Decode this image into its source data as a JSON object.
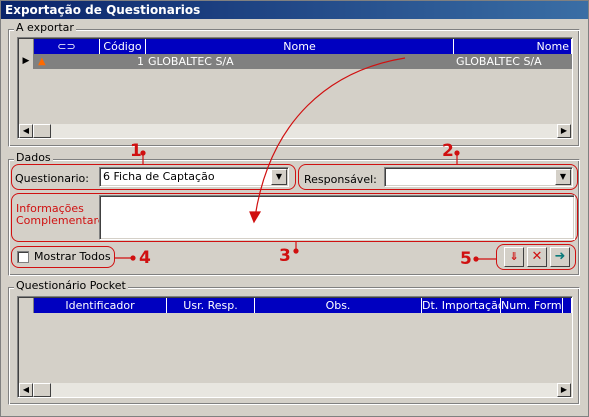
{
  "window": {
    "title": "Exportação de Questionarios"
  },
  "export_group": {
    "legend": "A exportar",
    "columns": [
      "",
      "Código",
      "Nome",
      "Nome"
    ],
    "rows": [
      {
        "codigo": "1",
        "nome": "GLOBALTEC S/A",
        "nome2": "GLOBALTEC S/A"
      }
    ]
  },
  "dados": {
    "legend": "Dados",
    "questionario_label": "Questionario:",
    "questionario_value": "6 Ficha de Captação",
    "responsavel_label": "Responsável:",
    "responsavel_value": "",
    "info_label_1": "Informações",
    "info_label_2": "Complementares:",
    "info_value": "",
    "mostrar_todos": "Mostrar Todos",
    "mostrar_todos_checked": false
  },
  "annotations": {
    "n1": "1",
    "n2": "2",
    "n3": "3",
    "n4": "4",
    "n5": "5"
  },
  "pocket_group": {
    "legend": "Questionário Pocket",
    "columns": [
      "Identificador",
      "Usr. Resp.",
      "Obs.",
      "Dt. Importação",
      "Num. Form."
    ]
  },
  "colors": {
    "header": "#0000c0",
    "annotation": "#d01010",
    "titlebar": "#0a246a"
  }
}
